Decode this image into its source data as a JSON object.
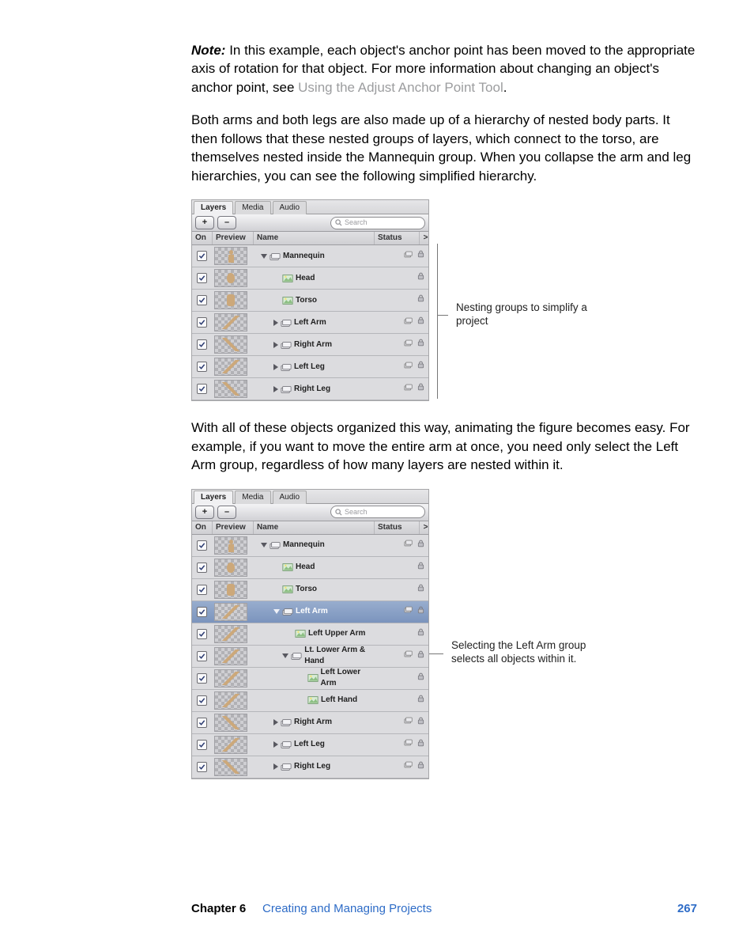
{
  "note": {
    "label": "Note:",
    "body_prefix": "In this example, each object's anchor point has been moved to the appropriate axis of rotation for that object. For more information about changing an object's anchor point, see ",
    "link": "Using the Adjust Anchor Point Tool",
    "body_suffix": "."
  },
  "para2": "Both arms and both legs are also made up of a hierarchy of nested body parts. It then follows that these nested groups of layers, which connect to the torso, are themselves nested inside the Mannequin group. When you collapse the arm and leg hierarchies, you can see the following simplified hierarchy.",
  "para3": "With all of these objects organized this way, animating the figure becomes easy. For example, if you want to move the entire arm at once, you need only select the Left Arm group, regardless of how many layers are nested within it.",
  "panel": {
    "tabs": [
      "Layers",
      "Media",
      "Audio"
    ],
    "search_placeholder": "Search",
    "headers": {
      "on": "On",
      "preview": "Preview",
      "name": "Name",
      "status": "Status",
      "chev": ">"
    },
    "buttons": {
      "add": "+",
      "remove": "–"
    }
  },
  "fig1": {
    "rows": [
      {
        "name": "Mannequin",
        "kind": "group",
        "disclose": "open",
        "depth": 0,
        "stack": true,
        "prev": "full"
      },
      {
        "name": "Head",
        "kind": "image",
        "disclose": "",
        "depth": 1,
        "stack": false,
        "prev": "head"
      },
      {
        "name": "Torso",
        "kind": "image",
        "disclose": "",
        "depth": 1,
        "stack": false,
        "prev": "torso"
      },
      {
        "name": "Left Arm",
        "kind": "group",
        "disclose": "closed",
        "depth": 1,
        "stack": true,
        "prev": "stick"
      },
      {
        "name": "Right Arm",
        "kind": "group",
        "disclose": "closed",
        "depth": 1,
        "stack": true,
        "prev": "stickr"
      },
      {
        "name": "Left Leg",
        "kind": "group",
        "disclose": "closed",
        "depth": 1,
        "stack": true,
        "prev": "stick"
      },
      {
        "name": "Right Leg",
        "kind": "group",
        "disclose": "closed",
        "depth": 1,
        "stack": true,
        "prev": "stickr"
      }
    ],
    "callout": "Nesting groups to simplify a project"
  },
  "fig2": {
    "rows": [
      {
        "name": "Mannequin",
        "kind": "group",
        "disclose": "open",
        "depth": 0,
        "stack": true,
        "prev": "full"
      },
      {
        "name": "Head",
        "kind": "image",
        "disclose": "",
        "depth": 1,
        "stack": false,
        "prev": "head"
      },
      {
        "name": "Torso",
        "kind": "image",
        "disclose": "",
        "depth": 1,
        "stack": false,
        "prev": "torso"
      },
      {
        "name": "Left Arm",
        "kind": "group",
        "disclose": "open",
        "depth": 1,
        "stack": true,
        "prev": "stick",
        "hl": true
      },
      {
        "name": "Left Upper Arm",
        "kind": "image",
        "disclose": "",
        "depth": 2,
        "stack": false,
        "prev": "stick"
      },
      {
        "name": "Lt. Lower Arm & Hand",
        "kind": "group",
        "disclose": "open",
        "depth": 2,
        "stack": true,
        "prev": "stick"
      },
      {
        "name": "Left Lower Arm",
        "kind": "image",
        "disclose": "",
        "depth": 3,
        "stack": false,
        "prev": "stick"
      },
      {
        "name": "Left Hand",
        "kind": "image",
        "disclose": "",
        "depth": 3,
        "stack": false,
        "prev": "stick"
      },
      {
        "name": "Right Arm",
        "kind": "group",
        "disclose": "closed",
        "depth": 1,
        "stack": true,
        "prev": "stickr"
      },
      {
        "name": "Left Leg",
        "kind": "group",
        "disclose": "closed",
        "depth": 1,
        "stack": true,
        "prev": "stick"
      },
      {
        "name": "Right Leg",
        "kind": "group",
        "disclose": "closed",
        "depth": 1,
        "stack": true,
        "prev": "stickr"
      }
    ],
    "callout": "Selecting the Left Arm group selects all objects within it."
  },
  "footer": {
    "chapter": "Chapter 6",
    "title": "Creating and Managing Projects",
    "page": "267"
  }
}
